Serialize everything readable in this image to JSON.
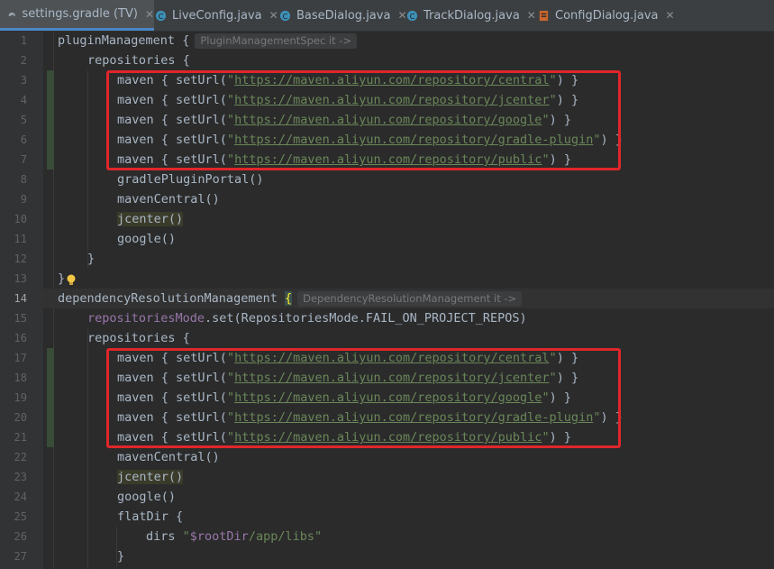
{
  "tabs": [
    {
      "label": "settings.gradle (TV)",
      "icon": "gradle-icon",
      "active": true
    },
    {
      "label": "LiveConfig.java",
      "icon": "java-class-icon"
    },
    {
      "label": "BaseDialog.java",
      "icon": "java-class-icon"
    },
    {
      "label": "TrackDialog.java",
      "icon": "java-class-icon"
    },
    {
      "label": "ConfigDialog.java",
      "icon": "java-class-icon"
    }
  ],
  "close_glyph": "✕",
  "line_numbers": [
    "1",
    "2",
    "3",
    "4",
    "5",
    "6",
    "7",
    "8",
    "9",
    "10",
    "11",
    "12",
    "13",
    "14",
    "15",
    "16",
    "17",
    "18",
    "19",
    "20",
    "21",
    "22",
    "23",
    "24",
    "25",
    "26",
    "27"
  ],
  "code": {
    "l1_name": "pluginManagement",
    "l1_brace": "{",
    "l1_hint": "PluginManagementSpec it ->",
    "repositories": "repositories {",
    "maven_prefix": "maven { setUrl(",
    "maven_suffix_close": ") }",
    "urls": [
      "https://maven.aliyun.com/repository/central",
      "https://maven.aliyun.com/repository/jcenter",
      "https://maven.aliyun.com/repository/google",
      "https://maven.aliyun.com/repository/gradle-plugin",
      "https://maven.aliyun.com/repository/public"
    ],
    "quote": "\"",
    "gradlePluginPortal": "gradlePluginPortal()",
    "mavenCentral": "mavenCentral()",
    "jcenter": "jcenter()",
    "google": "google()",
    "close": "}",
    "l14_name": "dependencyResolutionManagement",
    "l14_brace": "{",
    "l14_hint": "DependencyResolutionManagement it ->",
    "l15_prop": "repositoriesMode",
    "l15_rest": ".set(RepositoriesMode.FAIL_ON_PROJECT_REPOS)",
    "flatDir": "flatDir {",
    "dirs_kw": "dirs ",
    "dirs_q1": "\"",
    "dirs_var": "$rootDir",
    "dirs_path": "/app/libs\""
  }
}
